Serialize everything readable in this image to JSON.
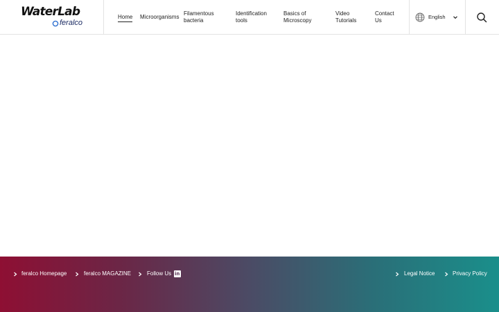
{
  "header": {
    "logo": {
      "title": "WaterLab",
      "subtitle": "feralco"
    },
    "nav": [
      {
        "label": "Home",
        "active": true
      },
      {
        "label": "Microorganisms"
      },
      {
        "label": "Filamentous bacteria"
      },
      {
        "label": "Identification tools"
      },
      {
        "label": "Basics of Microscopy"
      },
      {
        "label": "Video Tutorials"
      },
      {
        "label": "Contact Us"
      }
    ],
    "language": {
      "label": "English",
      "icon": "globe-icon"
    },
    "search_icon": "search-icon"
  },
  "footer": {
    "links_left": [
      {
        "label": "feralco Homepage"
      },
      {
        "label": "feralco MAGAZINE"
      },
      {
        "label": "Follow Us"
      }
    ],
    "social_icon": "linkedin-icon",
    "links_right": [
      {
        "label": "Legal Notice"
      },
      {
        "label": "Privacy Policy"
      }
    ]
  },
  "colors": {
    "footer_gradient_start": "#8e0f33",
    "footer_gradient_end": "#1a8f8b",
    "brand_blue": "#1b2b63"
  }
}
